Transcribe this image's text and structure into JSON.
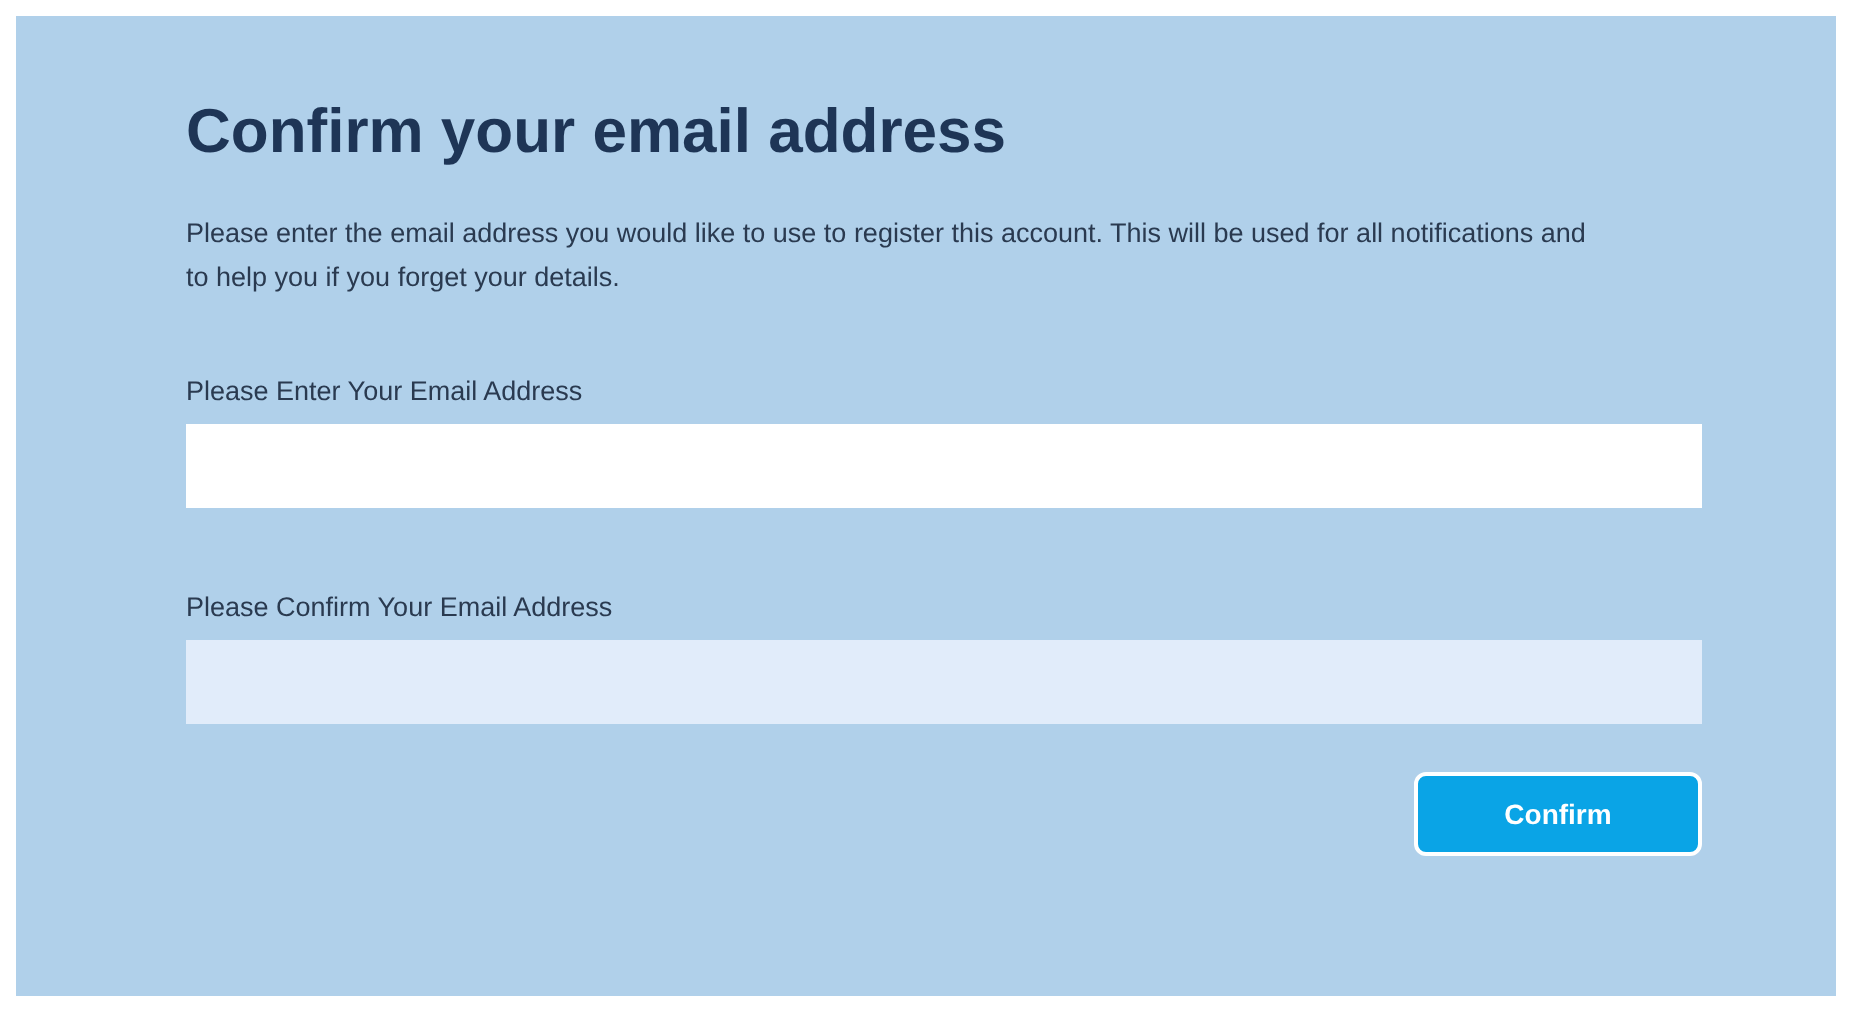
{
  "form": {
    "title": "Confirm your email address",
    "description": "Please enter the email address you would like to use to register this account. This will be used for all notifications and to help you if you forget your details.",
    "fields": [
      {
        "label": "Please Enter Your Email Address",
        "autofilled": false
      },
      {
        "label": "Please Confirm Your Email Address",
        "autofilled": true
      }
    ],
    "submit_button": "Confirm"
  }
}
